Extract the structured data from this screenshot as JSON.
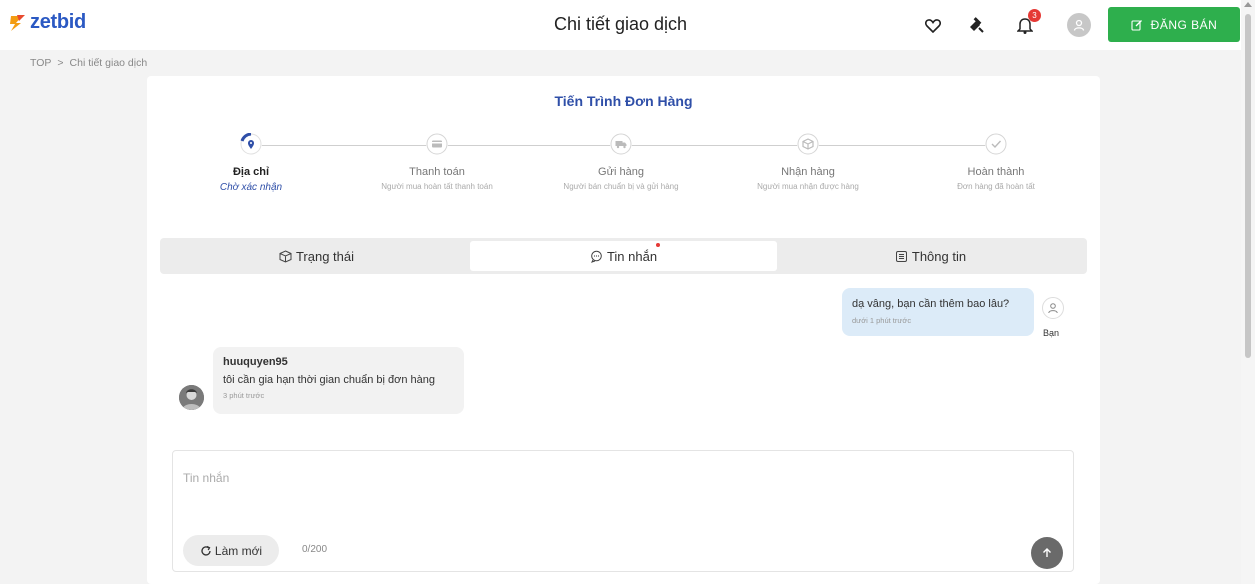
{
  "header": {
    "logo_text": "zetbid",
    "title": "Chi tiết giao dịch",
    "notification_count": "3",
    "post_button_label": "ĐĂNG BÁN",
    "icons": [
      "heart-icon",
      "gavel-icon",
      "bell-icon",
      "user-icon",
      "edit-icon"
    ]
  },
  "breadcrumb": {
    "home": "TOP",
    "separator": ">",
    "current": "Chi tiết giao dịch"
  },
  "progress": {
    "title": "Tiến Trình Đơn Hàng",
    "active_step": 0,
    "steps": [
      {
        "name": "Địa chỉ",
        "desc": "Chờ xác nhận",
        "icon": "location-icon"
      },
      {
        "name": "Thanh toán",
        "desc": "Người mua hoàn tất thanh toán",
        "icon": "card-icon"
      },
      {
        "name": "Gửi hàng",
        "desc": "Người bán chuẩn bị và gửi hàng",
        "icon": "truck-icon"
      },
      {
        "name": "Nhận hàng",
        "desc": "Người mua nhận được hàng",
        "icon": "box-icon"
      },
      {
        "name": "Hoàn thành",
        "desc": "Đơn hàng đã hoàn tất",
        "icon": "check-icon"
      }
    ]
  },
  "tabs": [
    {
      "label": "Trạng thái",
      "icon": "package-icon"
    },
    {
      "label": "Tin nhắn",
      "icon": "chat-icon",
      "active": true,
      "has_dot": true
    },
    {
      "label": "Thông tin",
      "icon": "list-icon"
    }
  ],
  "messages": {
    "mine": {
      "text": "dạ vâng, bạn cần thêm bao lâu?",
      "time": "dưới 1 phút trước",
      "sender_label": "Bạn"
    },
    "other": {
      "username": "huuquyen95",
      "text": "tôi cần gia hạn thời gian chuẩn bị đơn hàng",
      "time": "3 phút trước"
    }
  },
  "composer": {
    "placeholder": "Tin nhắn",
    "value": "",
    "refresh_label": "Làm mới",
    "counter": "0/200"
  },
  "colors": {
    "brand_blue": "#2f4fa8",
    "post_green": "#2eaf4d",
    "badge_red": "#e53935",
    "my_bubble": "#dcebf8"
  }
}
